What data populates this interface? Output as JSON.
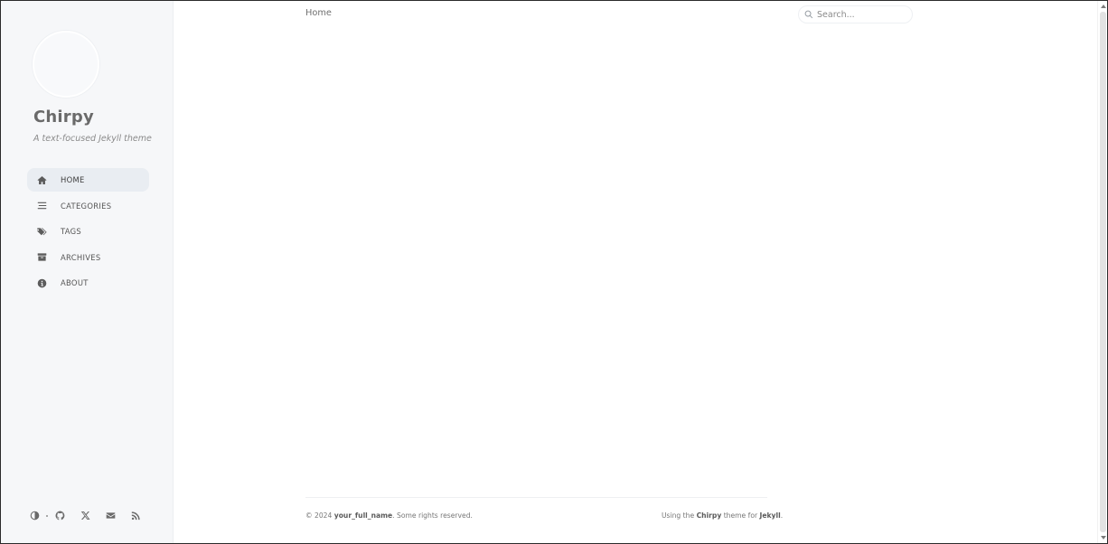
{
  "sidebar": {
    "title": "Chirpy",
    "subtitle": "A text-focused Jekyll theme",
    "nav": [
      {
        "label": "HOME",
        "icon": "home-icon",
        "active": true
      },
      {
        "label": "CATEGORIES",
        "icon": "stream-icon",
        "active": false
      },
      {
        "label": "TAGS",
        "icon": "tags-icon",
        "active": false
      },
      {
        "label": "ARCHIVES",
        "icon": "archive-icon",
        "active": false
      },
      {
        "label": "ABOUT",
        "icon": "info-circle-icon",
        "active": false
      }
    ],
    "bottom_icons": [
      "theme-toggle-icon",
      "github-icon",
      "x-twitter-icon",
      "email-icon",
      "rss-icon"
    ]
  },
  "topbar": {
    "breadcrumb": "Home",
    "search_placeholder": "Search..."
  },
  "footer": {
    "copyright_prefix": "© 2024 ",
    "author": "your_full_name",
    "copyright_suffix": ". Some rights reserved.",
    "using_prefix": "Using the ",
    "theme_name": "Chirpy",
    "theme_for": " theme for ",
    "jekyll": "Jekyll",
    "period": "."
  },
  "colors": {
    "sidebar_bg": "#f6f7f9",
    "active_nav_bg": "#e9edf2",
    "text": "#6c6c6c"
  }
}
